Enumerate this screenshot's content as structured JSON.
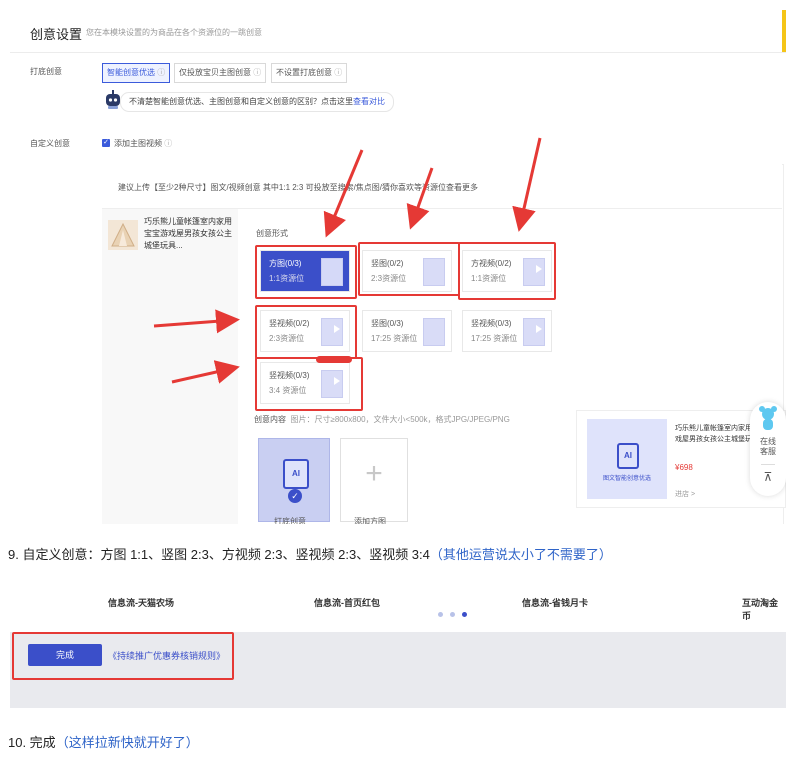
{
  "screen1": {
    "title": "创意设置",
    "subtitle": "您在本模块设置的为商品在各个资源位的一跳创意",
    "row1_label": "打底创意",
    "options": [
      "智能创意优选",
      "仅投放宝贝主图创意",
      "不设置打底创意"
    ],
    "tip_text": "不清楚智能创意优选、主图创意和自定义创意的区别？点击这里",
    "tip_link": "查看对比",
    "row2_label": "自定义创意",
    "checkbox_label": "添加主图视频",
    "upload_hint": "建议上传【至少2种尺寸】图文/视频创意 其中1:1 2:3 可投放至搜索/焦点图/猜你喜欢等资源位查看更多",
    "product_name": "巧乐熊儿童帐篷室内家用宝宝游戏屋男孩女孩公主城堡玩具...",
    "form_label": "创意形式",
    "slots": [
      {
        "name": "方图(0/3)",
        "sub": "1:1资源位"
      },
      {
        "name": "竖图(0/2)",
        "sub": "2:3资源位"
      },
      {
        "name": "方视频(0/2)",
        "sub": "1:1资源位"
      },
      {
        "name": "竖视频(0/2)",
        "sub": "2:3资源位"
      },
      {
        "name": "竖图(0/3)",
        "sub": "17:25 资源位"
      },
      {
        "name": "竖视频(0/3)",
        "sub": "17:25 资源位"
      },
      {
        "name": "竖视频(0/3)",
        "sub": "3:4 资源位"
      }
    ],
    "content_label": "创意内容",
    "content_hint": "图片：尺寸≥800x800，文件大小<500k，格式JPG/JPEG/PNG",
    "ai_tile_label": "打底创意",
    "add_tile_label": "添加方图",
    "ai_badge": "AI",
    "preview_title": "巧乐熊儿童帐篷室内家用宝宝游戏屋男孩女孩公主城堡玩具屋",
    "preview_price": "¥698",
    "preview_ai_caption": "图文智能创意优选",
    "preview_more": "进店 >",
    "cs_label1": "在线",
    "cs_label2": "客服",
    "cs_top_label": "TOP"
  },
  "caption9": {
    "main": "9.  自定义创意：方图 1:1、竖图 2:3、方视频 2:3、竖视频 2:3、竖视频 3:4",
    "note": "（其他运营说太小了不需要了）"
  },
  "screen2": {
    "tabs": [
      "信息流-天猫农场",
      "信息流-首页红包",
      "信息流-省钱月卡",
      "互动淘金币"
    ],
    "done_label": "完成",
    "rules_link": "《持续推广优惠券核销规则》"
  },
  "caption10": {
    "main": "10. 完成",
    "note": "（这样拉新快就开好了）"
  },
  "colors": {
    "accent": "#3b4fc9",
    "highlight": "#e53935",
    "note_blue": "#2f64c8"
  }
}
